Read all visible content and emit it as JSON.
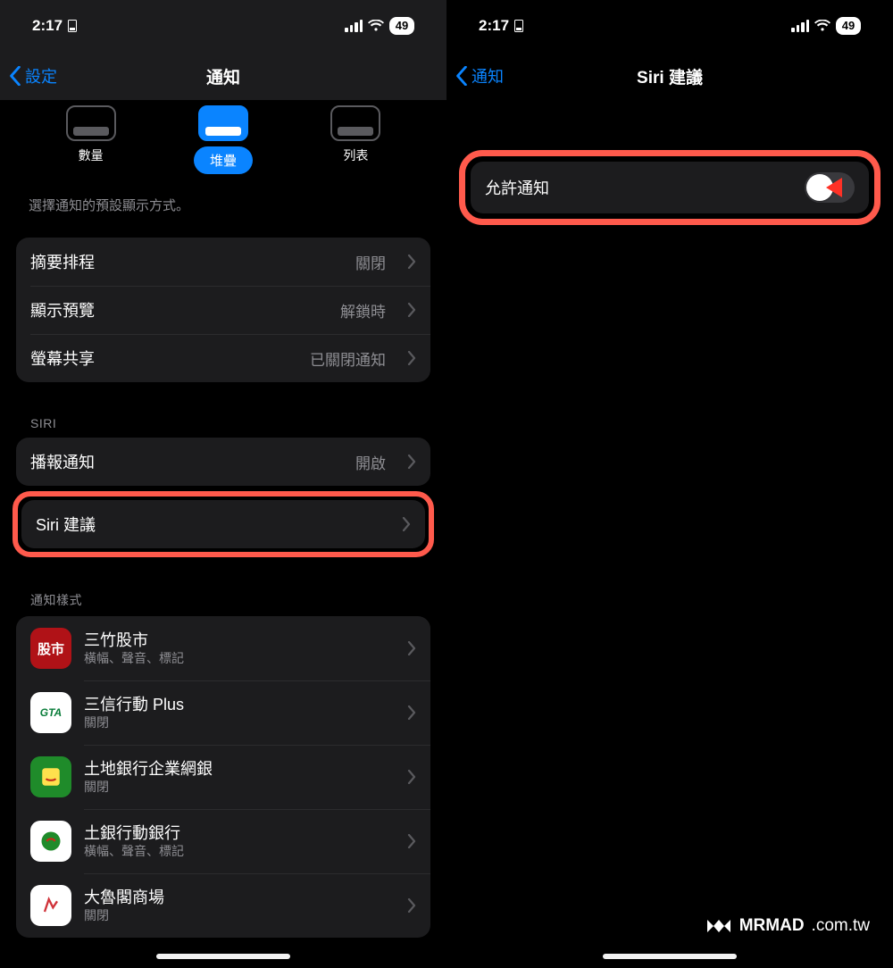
{
  "status": {
    "time": "2:17",
    "battery": "49"
  },
  "left": {
    "nav_back": "設定",
    "nav_title": "通知",
    "display_as": {
      "count": "數量",
      "stack": "堆疊",
      "list": "列表"
    },
    "helper": "選擇通知的預設顯示方式。",
    "general": [
      {
        "label": "摘要排程",
        "value": "關閉"
      },
      {
        "label": "顯示預覽",
        "value": "解鎖時"
      },
      {
        "label": "螢幕共享",
        "value": "已關閉通知"
      }
    ],
    "siri_header": "SIRI",
    "siri_rows": {
      "announce": {
        "label": "播報通知",
        "value": "開啟"
      },
      "suggestions": {
        "label": "Siri 建議"
      }
    },
    "style_header": "通知樣式",
    "apps": [
      {
        "name": "三竹股市",
        "sub": "橫幅、聲音、標記",
        "icon_text": "股市",
        "icon_bg": "#b01217"
      },
      {
        "name": "三信行動 Plus",
        "sub": "關閉",
        "icon_text": "GTA",
        "icon_bg": "#ffffff",
        "icon_fg": "#0a7d3a"
      },
      {
        "name": "土地銀行企業網銀",
        "sub": "關閉",
        "icon_text": "",
        "icon_bg": "#1f8b2a"
      },
      {
        "name": "土銀行動銀行",
        "sub": "橫幅、聲音、標記",
        "icon_text": "",
        "icon_bg": "#ffffff",
        "icon_fg": "#1f8b2a"
      },
      {
        "name": "大魯閣商場",
        "sub": "關閉",
        "icon_text": "",
        "icon_bg": "#ffffff"
      }
    ]
  },
  "right": {
    "nav_back": "通知",
    "nav_title": "Siri 建議",
    "allow_label": "允許通知"
  },
  "watermark": {
    "brand": "MRMAD",
    "suffix": ".com.tw"
  }
}
